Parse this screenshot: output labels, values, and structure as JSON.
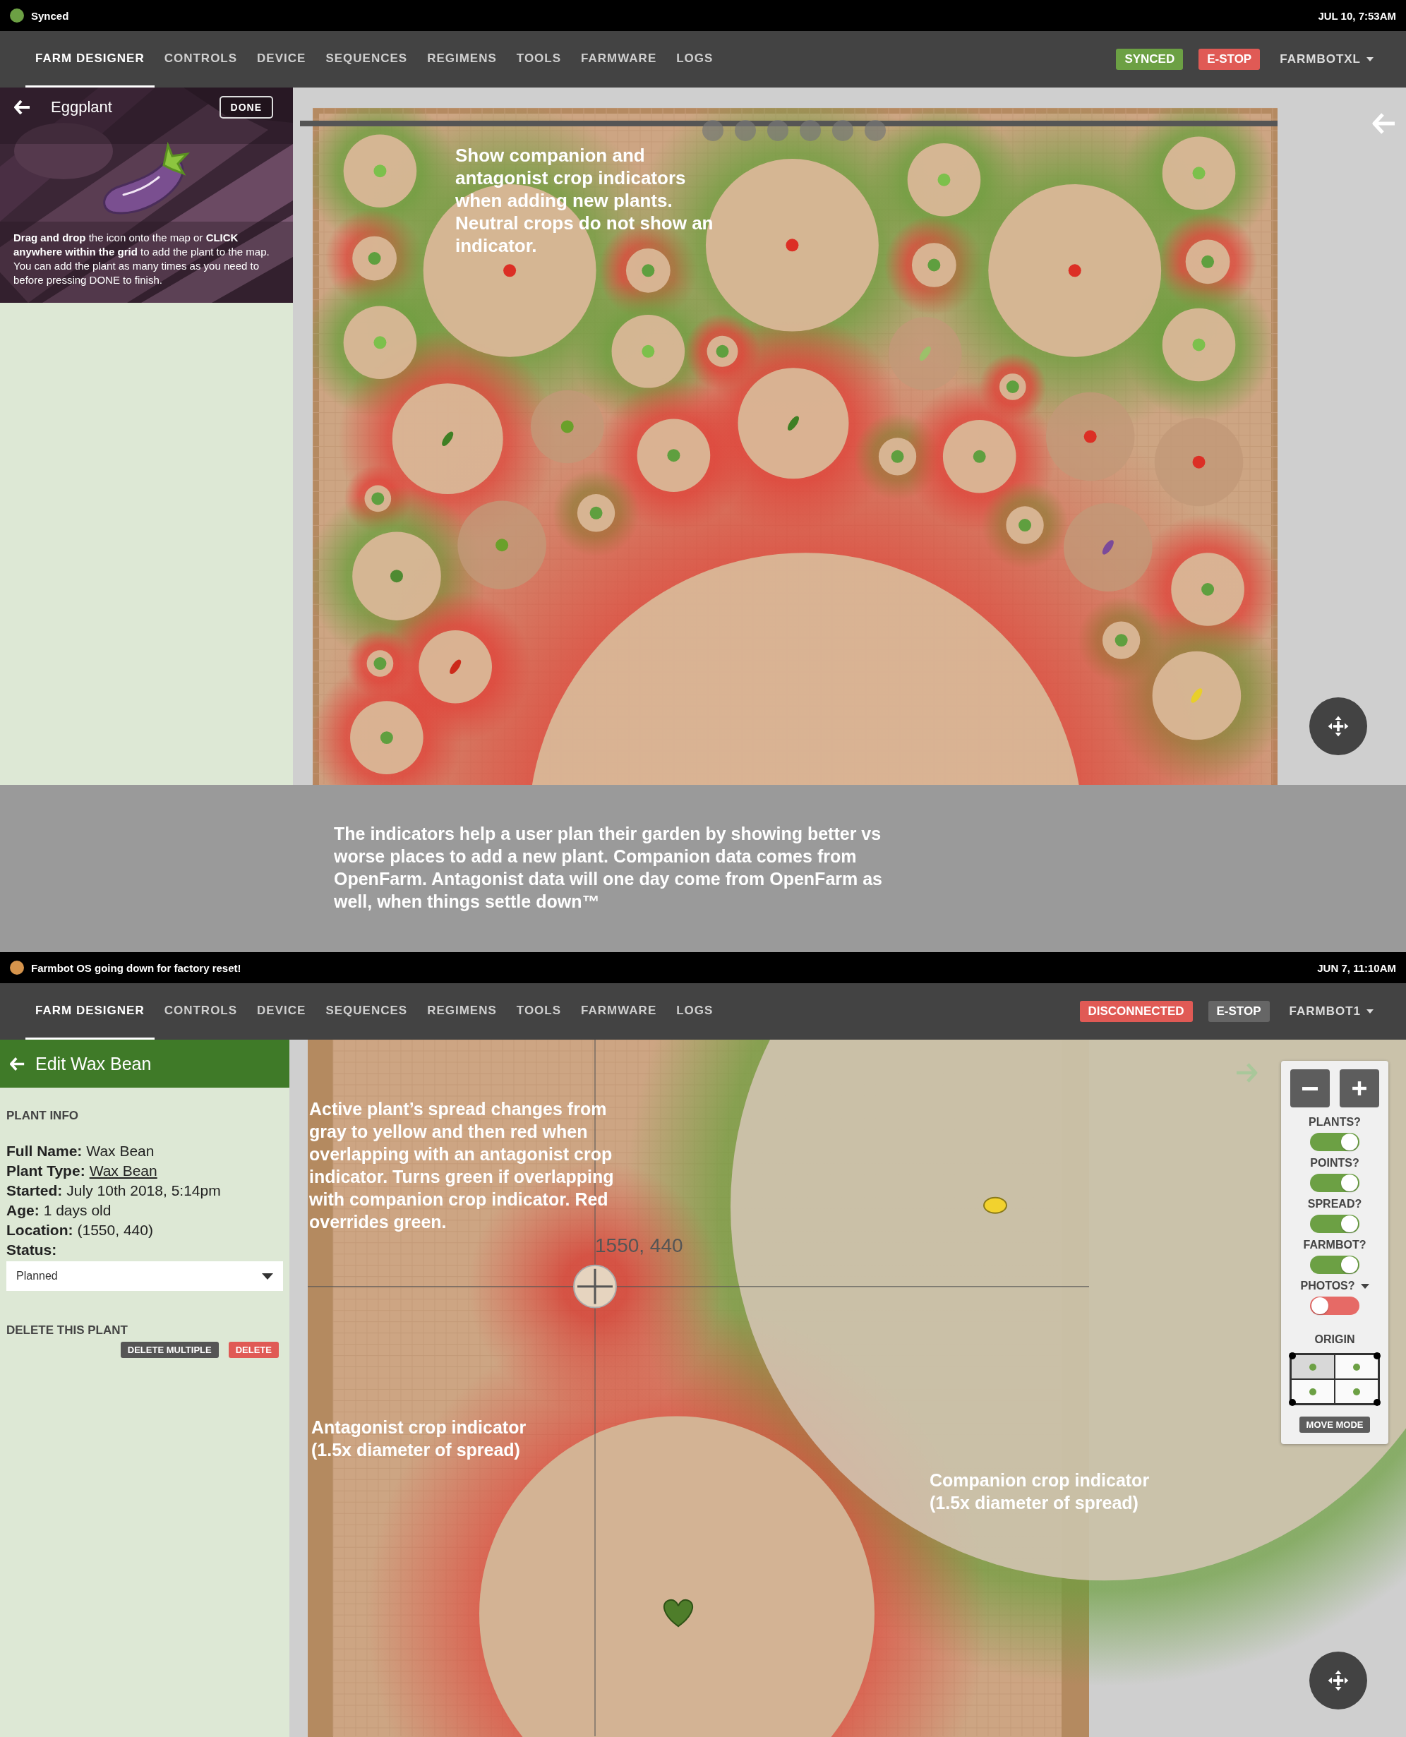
{
  "screens": [
    {
      "status": {
        "text": "Synced",
        "color": "#6ca044",
        "time": "JUL 10, 7:53AM"
      },
      "tabs": [
        {
          "label": "FARM DESIGNER",
          "selected": true
        },
        {
          "label": "CONTROLS",
          "selected": false
        },
        {
          "label": "DEVICE",
          "selected": false
        },
        {
          "label": "SEQUENCES",
          "selected": false
        },
        {
          "label": "REGIMENS",
          "selected": false
        },
        {
          "label": "TOOLS",
          "selected": false
        },
        {
          "label": "FARMWARE",
          "selected": false
        },
        {
          "label": "LOGS",
          "selected": false
        }
      ],
      "sync_badge": {
        "label": "SYNCED",
        "kind": "synced"
      },
      "estop": {
        "label": "E-STOP",
        "disabled": false
      },
      "account": "FARMBOTXL"
    },
    {
      "status": {
        "text": "Farmbot OS going down for factory reset!",
        "color": "#d6944c",
        "time": "JUN 7, 11:10AM"
      },
      "tabs": [
        {
          "label": "FARM DESIGNER",
          "selected": true
        },
        {
          "label": "CONTROLS",
          "selected": false
        },
        {
          "label": "DEVICE",
          "selected": false
        },
        {
          "label": "SEQUENCES",
          "selected": false
        },
        {
          "label": "REGIMENS",
          "selected": false
        },
        {
          "label": "TOOLS",
          "selected": false
        },
        {
          "label": "FARMWARE",
          "selected": false
        },
        {
          "label": "LOGS",
          "selected": false
        }
      ],
      "sync_badge": {
        "label": "DISCONNECTED",
        "kind": "disconnected"
      },
      "estop": {
        "label": "E-STOP",
        "disabled": true
      },
      "account": "FARMBOT1"
    }
  ],
  "add_plant": {
    "title": "Eggplant",
    "done": "DONE",
    "instructions": "**Drag and drop** the icon onto the map or **CLICK anywhere within the grid** to add the plant to the map. You can add the plant as many times as you need to before pressing DONE to finish.",
    "note": "Show companion and antagonist crop indicators when adding new plants. Neutral crops do not show an indicator."
  },
  "caption": "The indicators help a user plan their garden by showing better vs worse places to add a new plant. Companion data comes from OpenFarm. Antagonist data will one day come from OpenFarm as well, when things settle down™",
  "edit_plant": {
    "title": "Edit Wax Bean",
    "section": "PLANT INFO",
    "fields": [
      {
        "label": "Full Name:",
        "value": "Wax Bean",
        "link": false
      },
      {
        "label": "Plant Type:",
        "value": "Wax Bean",
        "link": true
      },
      {
        "label": "Started:",
        "value": "July 10th 2018, 5:14pm",
        "link": false
      },
      {
        "label": "Age:",
        "value": "1 days old",
        "link": false
      },
      {
        "label": "Location:",
        "value": "(1550, 440)",
        "link": false
      }
    ],
    "status_label": "Status:",
    "status_value": "Planned",
    "delete_section": "DELETE THIS PLANT",
    "delete_multiple": "DELETE MULTIPLE",
    "delete": "DELETE",
    "coordinates": "1550, 440",
    "notes": [
      {
        "kind": "active",
        "text": "Active plant’s spread changes from gray to yellow and then red when overlapping with an antagonist crop indicator. Turns green if overlapping with companion crop indicator. Red overrides green."
      },
      {
        "kind": "antagonist",
        "text": "Antagonist crop indicator (1.5x diameter of spread)"
      },
      {
        "kind": "companion",
        "text": "Companion crop indicator (1.5x diameter of spread)"
      }
    ],
    "toggles": [
      {
        "label": "PLANTS?",
        "on": true,
        "menu": false
      },
      {
        "label": "POINTS?",
        "on": true,
        "menu": false
      },
      {
        "label": "SPREAD?",
        "on": true,
        "menu": false
      },
      {
        "label": "FARMBOT?",
        "on": true,
        "menu": false
      },
      {
        "label": "PHOTOS?",
        "on": false,
        "menu": true
      }
    ],
    "origin_label": "ORIGIN",
    "origins": [
      {
        "selected": true
      },
      {
        "selected": false
      },
      {
        "selected": false
      },
      {
        "selected": false
      }
    ],
    "move_mode": "MOVE MODE"
  }
}
